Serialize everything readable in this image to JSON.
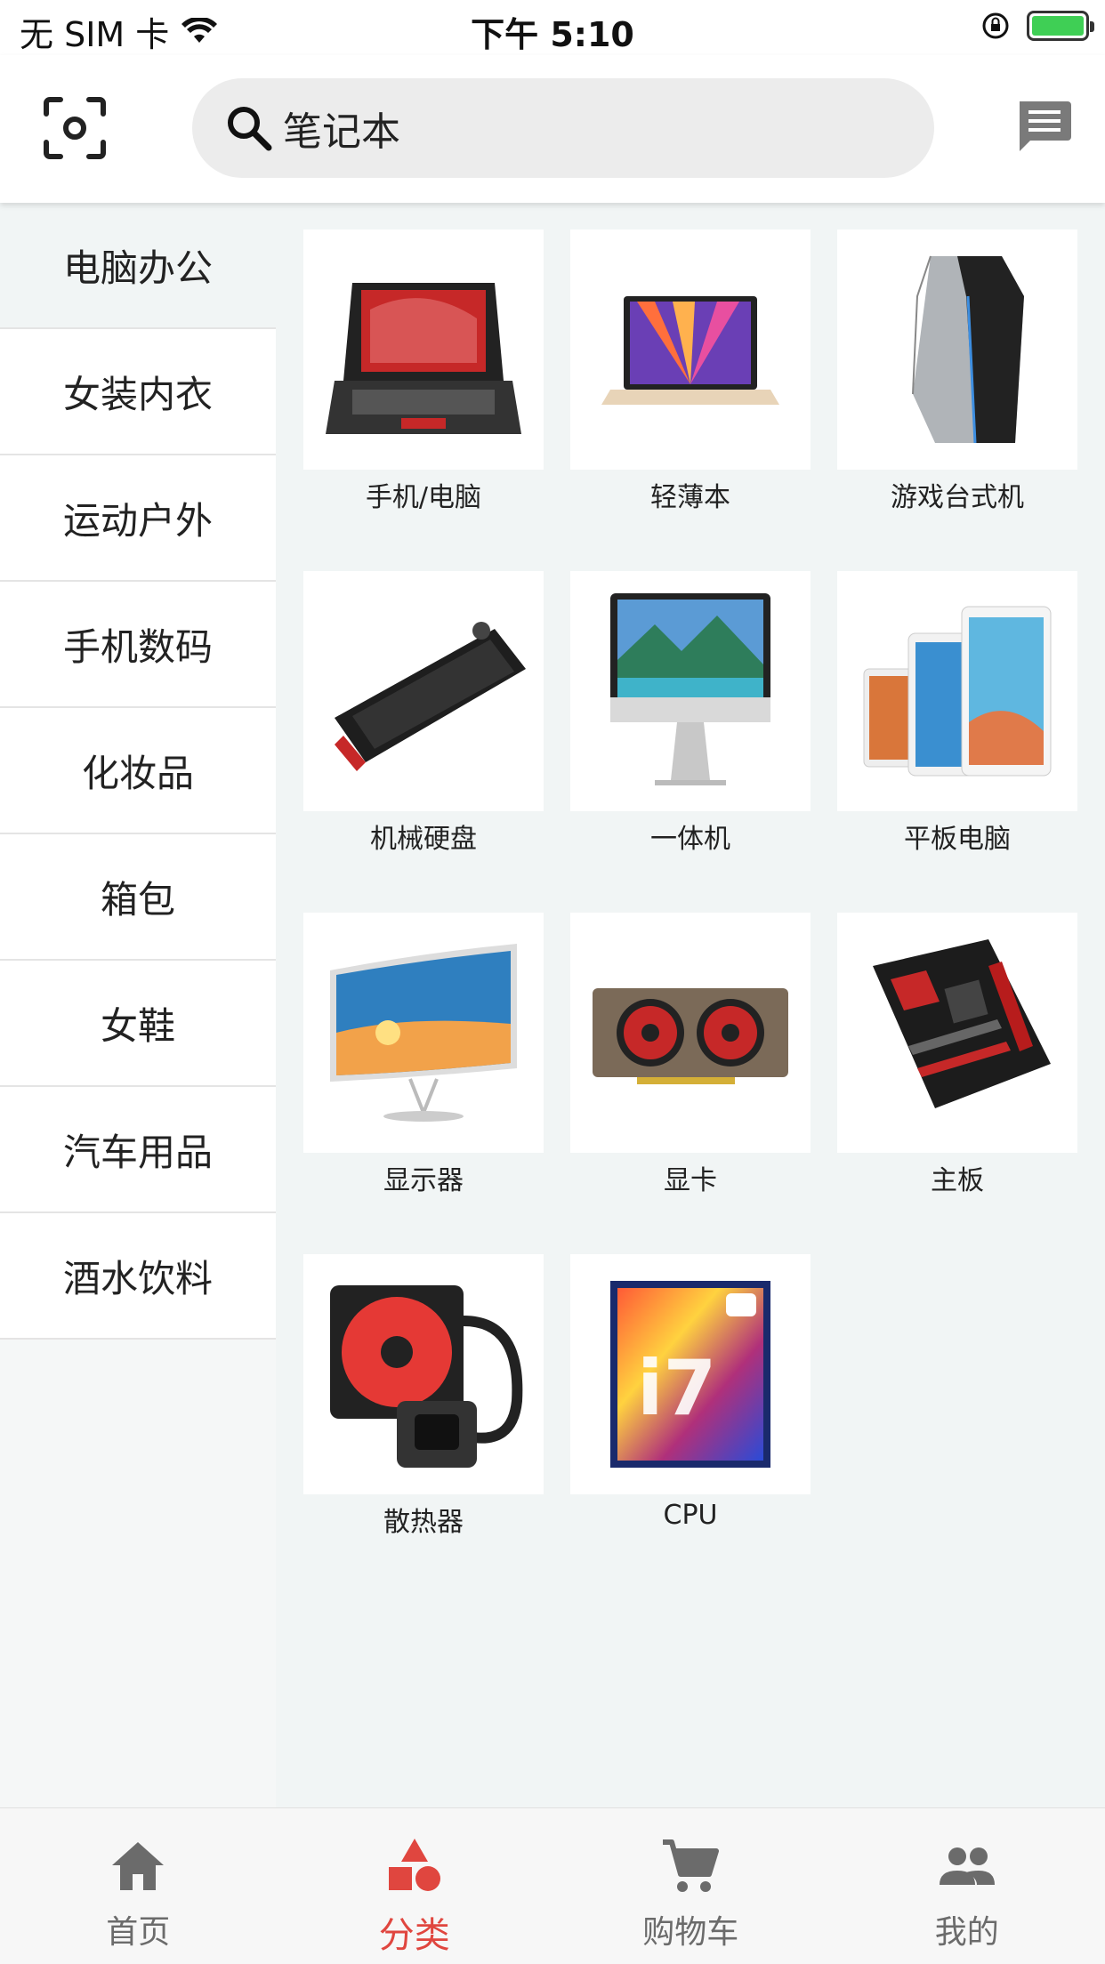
{
  "status_bar": {
    "carrier": "无 SIM 卡",
    "time": "下午 5:10"
  },
  "header": {
    "search_text": "笔记本",
    "scan_icon": "scan-icon",
    "message_icon": "message-icon"
  },
  "sidebar": {
    "items": [
      {
        "label": "电脑办公",
        "active": true
      },
      {
        "label": "女装内衣",
        "active": false
      },
      {
        "label": "运动户外",
        "active": false
      },
      {
        "label": "手机数码",
        "active": false
      },
      {
        "label": "化妆品",
        "active": false
      },
      {
        "label": "箱包",
        "active": false
      },
      {
        "label": "女鞋",
        "active": false
      },
      {
        "label": "汽车用品",
        "active": false
      },
      {
        "label": "酒水饮料",
        "active": false
      }
    ]
  },
  "grid": {
    "items": [
      {
        "label": "手机/电脑",
        "icon": "laptop-image"
      },
      {
        "label": "轻薄本",
        "icon": "ultrabook-image"
      },
      {
        "label": "游戏台式机",
        "icon": "gaming-desktop-image"
      },
      {
        "label": "机械硬盘",
        "icon": "keyboard-image"
      },
      {
        "label": "一体机",
        "icon": "all-in-one-image"
      },
      {
        "label": "平板电脑",
        "icon": "tablet-image"
      },
      {
        "label": "显示器",
        "icon": "monitor-image"
      },
      {
        "label": "显卡",
        "icon": "graphics-card-image"
      },
      {
        "label": "主板",
        "icon": "motherboard-image"
      },
      {
        "label": "散热器",
        "icon": "cooler-image"
      },
      {
        "label": "CPU",
        "icon": "cpu-image"
      }
    ]
  },
  "bottom_nav": {
    "items": [
      {
        "label": "首页",
        "icon": "home-icon",
        "active": false
      },
      {
        "label": "分类",
        "icon": "category-icon",
        "active": true
      },
      {
        "label": "购物车",
        "icon": "cart-icon",
        "active": false
      },
      {
        "label": "我的",
        "icon": "people-icon",
        "active": false
      }
    ]
  },
  "colors": {
    "accent": "#e0463f",
    "background": "#f1f5f5",
    "inactive_nav": "#6b6b6b"
  }
}
